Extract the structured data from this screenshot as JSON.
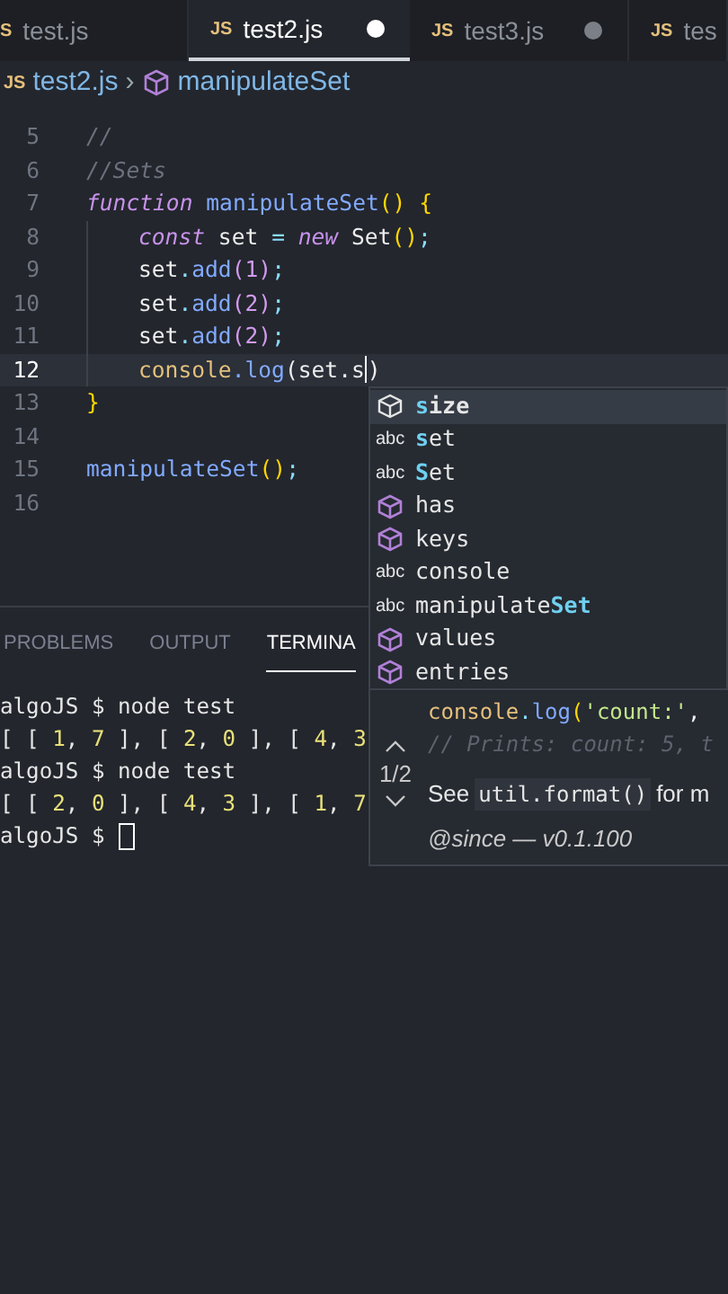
{
  "tabs": [
    {
      "icon": "S",
      "label": "test.js",
      "selected": false,
      "dirty": false
    },
    {
      "icon": "JS",
      "label": "test2.js",
      "selected": true,
      "dirty": true
    },
    {
      "icon": "JS",
      "label": "test3.js",
      "selected": false,
      "dirty": true
    },
    {
      "icon": "JS",
      "label": "tes",
      "selected": false
    }
  ],
  "breadcrumb": {
    "icon": "JS",
    "file": "test2.js",
    "separator": "›",
    "symbol": "manipulateSet"
  },
  "code_lines": [
    {
      "number": "5",
      "current": false,
      "tokens": [
        {
          "t": "//",
          "kind": "comment"
        }
      ]
    },
    {
      "number": "6",
      "current": false,
      "tokens": [
        {
          "t": "//Sets",
          "kind": "comment"
        }
      ]
    },
    {
      "number": "7",
      "current": false,
      "tokens": [
        {
          "t": "function",
          "kind": "keyword"
        },
        {
          "t": " manipulateSet",
          "kind": "function"
        },
        {
          "t": "() {",
          "kind": "bracket"
        }
      ]
    },
    {
      "number": "8",
      "indent": true,
      "current": false,
      "tokens": [
        {
          "t": "const",
          "kind": "keyword"
        },
        {
          "t": " set ",
          "kind": "identifier"
        },
        {
          "t": "=",
          "kind": "operator"
        },
        {
          "t": " new",
          "kind": "keyword"
        },
        {
          "t": " Set",
          "kind": "identifier"
        },
        {
          "t": "()",
          "kind": "bracket"
        },
        {
          "t": ";",
          "kind": "operator"
        }
      ]
    },
    {
      "number": "9",
      "indent": true,
      "current": false,
      "tokens": [
        {
          "t": "set",
          "kind": "identifier"
        },
        {
          "t": ".",
          "kind": "operator"
        },
        {
          "t": "add",
          "kind": "function"
        },
        {
          "t": "(",
          "kind": "number"
        },
        {
          "t": "1",
          "kind": "number"
        },
        {
          "t": ")",
          "kind": "number"
        },
        {
          "t": ";",
          "kind": "operator"
        }
      ]
    },
    {
      "number": "10",
      "indent": true,
      "current": false,
      "tokens": [
        {
          "t": "set",
          "kind": "identifier"
        },
        {
          "t": ".",
          "kind": "operator"
        },
        {
          "t": "add",
          "kind": "function"
        },
        {
          "t": "(",
          "kind": "number"
        },
        {
          "t": "2",
          "kind": "number"
        },
        {
          "t": ")",
          "kind": "number"
        },
        {
          "t": ";",
          "kind": "operator"
        }
      ]
    },
    {
      "number": "11",
      "indent": true,
      "current": false,
      "tokens": [
        {
          "t": "set",
          "kind": "identifier"
        },
        {
          "t": ".",
          "kind": "operator"
        },
        {
          "t": "add",
          "kind": "function"
        },
        {
          "t": "(",
          "kind": "number"
        },
        {
          "t": "2",
          "kind": "number"
        },
        {
          "t": ")",
          "kind": "number"
        },
        {
          "t": ";",
          "kind": "operator"
        }
      ]
    },
    {
      "number": "12",
      "indent": true,
      "current": true,
      "tokens": [
        {
          "t": "console",
          "kind": "object"
        },
        {
          "t": ".log",
          "kind": "function"
        },
        {
          "t": "(set.s",
          "kind": "identifier"
        },
        {
          "t": ")",
          "kind": "identifier"
        }
      ]
    },
    {
      "number": "13",
      "current": false,
      "tokens": [
        {
          "t": "}",
          "kind": "bracket"
        }
      ]
    },
    {
      "number": "14",
      "current": false
    },
    {
      "number": "15",
      "current": false,
      "tokens": [
        {
          "t": "manipulateSet",
          "kind": "function"
        },
        {
          "t": "()",
          "kind": "bracket"
        },
        {
          "t": ";",
          "kind": "operator"
        }
      ]
    },
    {
      "number": "16",
      "current": false
    }
  ],
  "panel_tabs": [
    {
      "label": "PROBLEMS",
      "selected": false
    },
    {
      "label": "OUTPUT",
      "selected": false
    },
    {
      "label": "TERMINA",
      "selected": true
    }
  ],
  "terminal_lines": [
    {
      "tokens": [
        {
          "t": "algoJS $ node test",
          "kind": "text"
        }
      ]
    },
    {
      "tokens": [
        {
          "t": "[ [ ",
          "kind": "text"
        },
        {
          "t": "1",
          "kind": "number"
        },
        {
          "t": ", ",
          "kind": "text"
        },
        {
          "t": "7",
          "kind": "number"
        },
        {
          "t": " ], [ ",
          "kind": "text"
        },
        {
          "t": "2",
          "kind": "number"
        },
        {
          "t": ", ",
          "kind": "text"
        },
        {
          "t": "0",
          "kind": "number"
        },
        {
          "t": " ], [ ",
          "kind": "text"
        },
        {
          "t": "4",
          "kind": "number"
        },
        {
          "t": ", ",
          "kind": "text"
        },
        {
          "t": "3",
          "kind": "number"
        }
      ]
    },
    {
      "tokens": [
        {
          "t": "algoJS $ node test",
          "kind": "text"
        }
      ]
    },
    {
      "tokens": [
        {
          "t": "[ [ ",
          "kind": "text"
        },
        {
          "t": "2",
          "kind": "number"
        },
        {
          "t": ", ",
          "kind": "text"
        },
        {
          "t": "0",
          "kind": "number"
        },
        {
          "t": " ], [ ",
          "kind": "text"
        },
        {
          "t": "4",
          "kind": "number"
        },
        {
          "t": ", ",
          "kind": "text"
        },
        {
          "t": "3",
          "kind": "number"
        },
        {
          "t": " ], [ ",
          "kind": "text"
        },
        {
          "t": "1",
          "kind": "number"
        },
        {
          "t": ", ",
          "kind": "text"
        },
        {
          "t": "7",
          "kind": "number"
        }
      ]
    },
    {
      "tokens": [
        {
          "t": "algoJS $ ",
          "kind": "text"
        }
      ],
      "cursor": true
    }
  ],
  "suggestions": [
    {
      "kind": "property",
      "match": "s",
      "suffix": "ize",
      "selected": true
    },
    {
      "kind": "text",
      "icon": "abc",
      "match": "s",
      "suffix": "et",
      "selected": false
    },
    {
      "kind": "text",
      "icon": "abc",
      "match": "S",
      "suffix": "et",
      "selected": false
    },
    {
      "kind": "method",
      "suffix": "has",
      "selected": false
    },
    {
      "kind": "method",
      "suffix": "keys",
      "selected": false
    },
    {
      "kind": "text",
      "icon": "abc",
      "suffix": "console",
      "selected": false
    },
    {
      "kind": "text",
      "icon": "abc",
      "prefix": "manipulate",
      "match": "Set",
      "selected": false
    },
    {
      "kind": "method",
      "suffix": "values",
      "selected": false
    },
    {
      "kind": "method",
      "suffix": "entries",
      "selected": false
    }
  ],
  "docs": {
    "counter": "1/2",
    "code_line": [
      {
        "t": "console",
        "kind": "object"
      },
      {
        "t": ".",
        "kind": "operator"
      },
      {
        "t": "log",
        "kind": "function"
      },
      {
        "t": "(",
        "kind": "bracket"
      },
      {
        "t": "'count:'",
        "kind": "string"
      },
      {
        "t": ",",
        "kind": "identifier"
      }
    ],
    "comment_line": "// Prints: count: 5, t",
    "see_prefix": "See",
    "see_code": "util.format()",
    "see_suffix": "for m",
    "since": "@since — v0.1.100"
  }
}
